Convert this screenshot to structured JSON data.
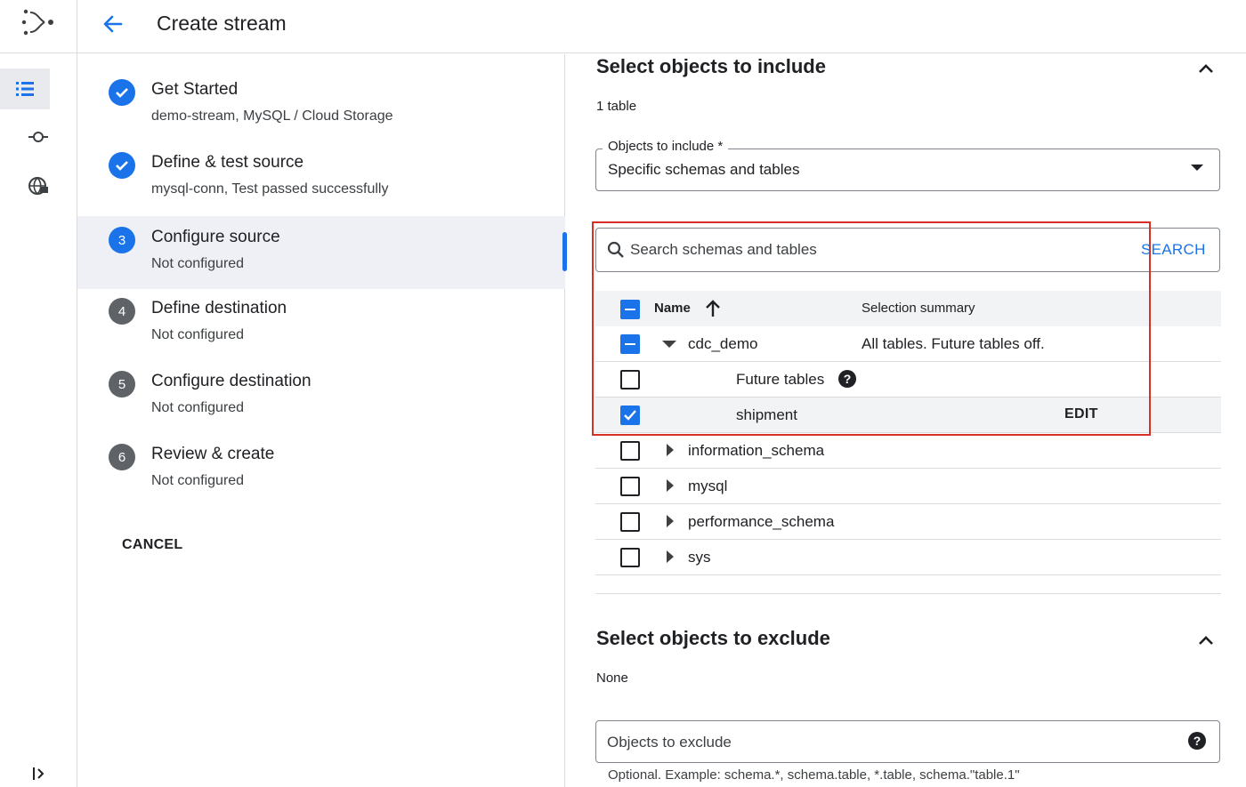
{
  "header": {
    "title": "Create stream"
  },
  "steps": [
    {
      "number": "1",
      "label": "Get Started",
      "sub": "demo-stream, MySQL / Cloud Storage",
      "state": "done"
    },
    {
      "number": "2",
      "label": "Define & test source",
      "sub": "mysql-conn, Test passed successfully",
      "state": "done"
    },
    {
      "number": "3",
      "label": "Configure source",
      "sub": "Not configured",
      "state": "current"
    },
    {
      "number": "4",
      "label": "Define destination",
      "sub": "Not configured",
      "state": "todo"
    },
    {
      "number": "5",
      "label": "Configure destination",
      "sub": "Not configured",
      "state": "todo"
    },
    {
      "number": "6",
      "label": "Review & create",
      "sub": "Not configured",
      "state": "todo"
    }
  ],
  "cancel_label": "CANCEL",
  "include": {
    "title": "Select objects to include",
    "count": "1 table",
    "objects_label": "Objects to include *",
    "objects_value": "Specific schemas and tables",
    "search_placeholder": "Search schemas and tables",
    "search_button": "SEARCH",
    "columns": {
      "name": "Name",
      "summary": "Selection summary"
    },
    "rows": [
      {
        "name": "cdc_demo",
        "summary": "All tables. Future tables off.",
        "check": "indeterminate",
        "expanded": true
      },
      {
        "name": "Future tables",
        "check": "off",
        "help": "?"
      },
      {
        "name": "shipment",
        "check": "on",
        "action": "EDIT"
      },
      {
        "name": "information_schema",
        "check": "off"
      },
      {
        "name": "mysql",
        "check": "off"
      },
      {
        "name": "performance_schema",
        "check": "off"
      },
      {
        "name": "sys",
        "check": "off"
      }
    ]
  },
  "exclude": {
    "title": "Select objects to exclude",
    "value": "None",
    "placeholder": "Objects to exclude",
    "hint": "Optional. Example: schema.*, schema.table, *.table, schema.\"table.1\""
  },
  "colors": {
    "accent": "#1a73e8",
    "highlight": "#d93025",
    "stepTodo": "#5f6368"
  }
}
